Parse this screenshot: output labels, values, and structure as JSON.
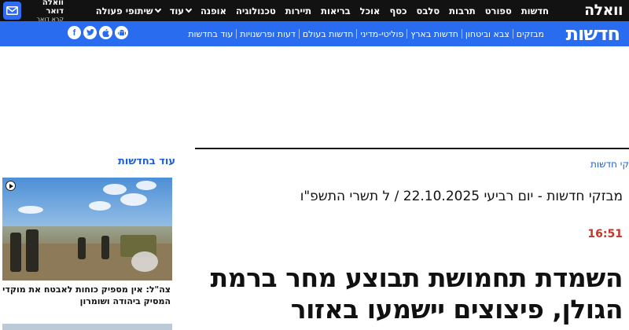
{
  "topnav": {
    "logo": "וואלה",
    "categories": [
      "חדשות",
      "ספורט",
      "תרבות",
      "סלבס",
      "כסף",
      "אוכל",
      "בריאות",
      "תיירות",
      "טכנולוגיה",
      "אופנה",
      "עוד"
    ],
    "partners": "שיתופי פעולה",
    "mail_title": "וואלה דואר",
    "mail_sub": "קרא דואר"
  },
  "section": {
    "title": "חדשות",
    "subnav": [
      "מבזקים",
      "צבא וביטחון",
      "חדשות בארץ",
      "פוליטי-מדיני",
      "חדשות בעולם",
      "דעות ופרשנויות",
      "עוד בחדשות"
    ],
    "social": [
      "facebook-icon",
      "twitter-icon",
      "apple-icon",
      "android-icon"
    ]
  },
  "article": {
    "breadcrumb": "קי חדשות",
    "date_title": "מבזקי חדשות - יום רביעי 22.10.2025 / ל תשרי התשפ\"ו",
    "time": "16:51",
    "headline": "השמדת תחמושת תבוצע מחר ברמת הגולן, פיצוצים יישמעו באזור"
  },
  "sidebar": {
    "title": "עוד בחדשות",
    "card_caption": "צה\"ל: אין מספיק כוחות לאבטח את מוקדי המסיק ביהודה ושומרון"
  },
  "colors": {
    "topnav_bg": "#121212",
    "brand_blue": "#2a6cf0",
    "time_red": "#c0392b",
    "link_blue": "#1f5fd1"
  }
}
